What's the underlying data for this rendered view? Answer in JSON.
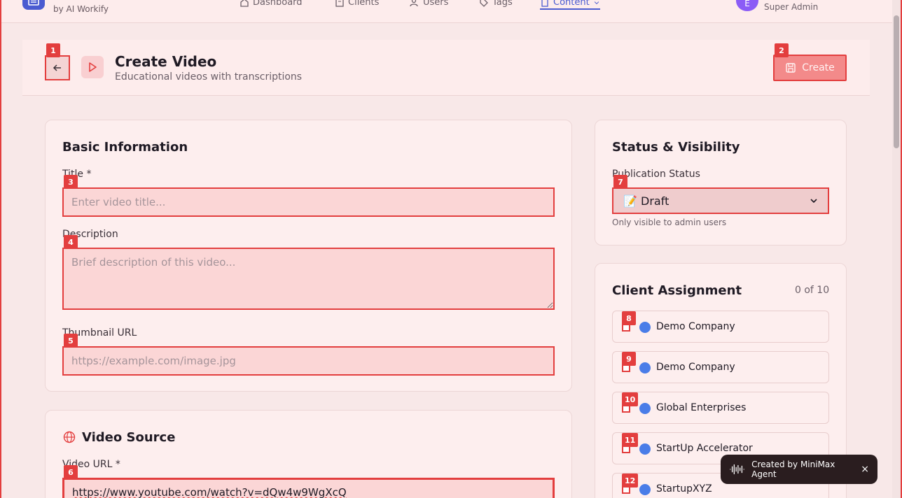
{
  "nav": {
    "brand_sub": "by AI Workify",
    "items": [
      {
        "label": "Dashboard",
        "icon": "home-icon"
      },
      {
        "label": "Clients",
        "icon": "building-icon"
      },
      {
        "label": "Users",
        "icon": "users-icon"
      },
      {
        "label": "Tags",
        "icon": "tag-icon"
      },
      {
        "label": "Content",
        "icon": "document-icon",
        "active": true
      }
    ],
    "user_initial": "E",
    "user_role": "Super Admin"
  },
  "header": {
    "back_marker": "1",
    "title": "Create Video",
    "subtitle": "Educational videos with transcriptions",
    "create_label": "Create",
    "create_marker": "2"
  },
  "basic": {
    "title": "Basic Information",
    "title_label": "Title *",
    "title_placeholder": "Enter video title...",
    "title_marker": "3",
    "desc_label": "Description",
    "desc_placeholder": "Brief description of this video...",
    "desc_marker": "4",
    "thumb_label": "Thumbnail URL",
    "thumb_placeholder": "https://example.com/image.jpg",
    "thumb_marker": "5"
  },
  "source": {
    "title": "Video Source",
    "url_label": "Video URL *",
    "url_value": "https://www.youtube.com/watch?v=dQw4w9WgXcQ",
    "url_marker": "6"
  },
  "status": {
    "title": "Status & Visibility",
    "pub_label": "Publication Status",
    "pub_value": "📝 Draft",
    "pub_marker": "7",
    "hint": "Only visible to admin users"
  },
  "clients": {
    "title": "Client Assignment",
    "count": "0 of 10",
    "items": [
      {
        "name": "Demo Company",
        "marker": "8"
      },
      {
        "name": "Demo Company",
        "marker": "9"
      },
      {
        "name": "Global Enterprises",
        "marker": "10"
      },
      {
        "name": "StartUp Accelerator",
        "marker": "11"
      },
      {
        "name": "StartupXYZ",
        "marker": "12"
      }
    ]
  },
  "toast": {
    "label": "Created by MiniMax Agent",
    "close": "×"
  },
  "colors": {
    "accent": "#4a5bd1",
    "marker": "#e33e3e",
    "client_dot": "#4a7de8"
  }
}
